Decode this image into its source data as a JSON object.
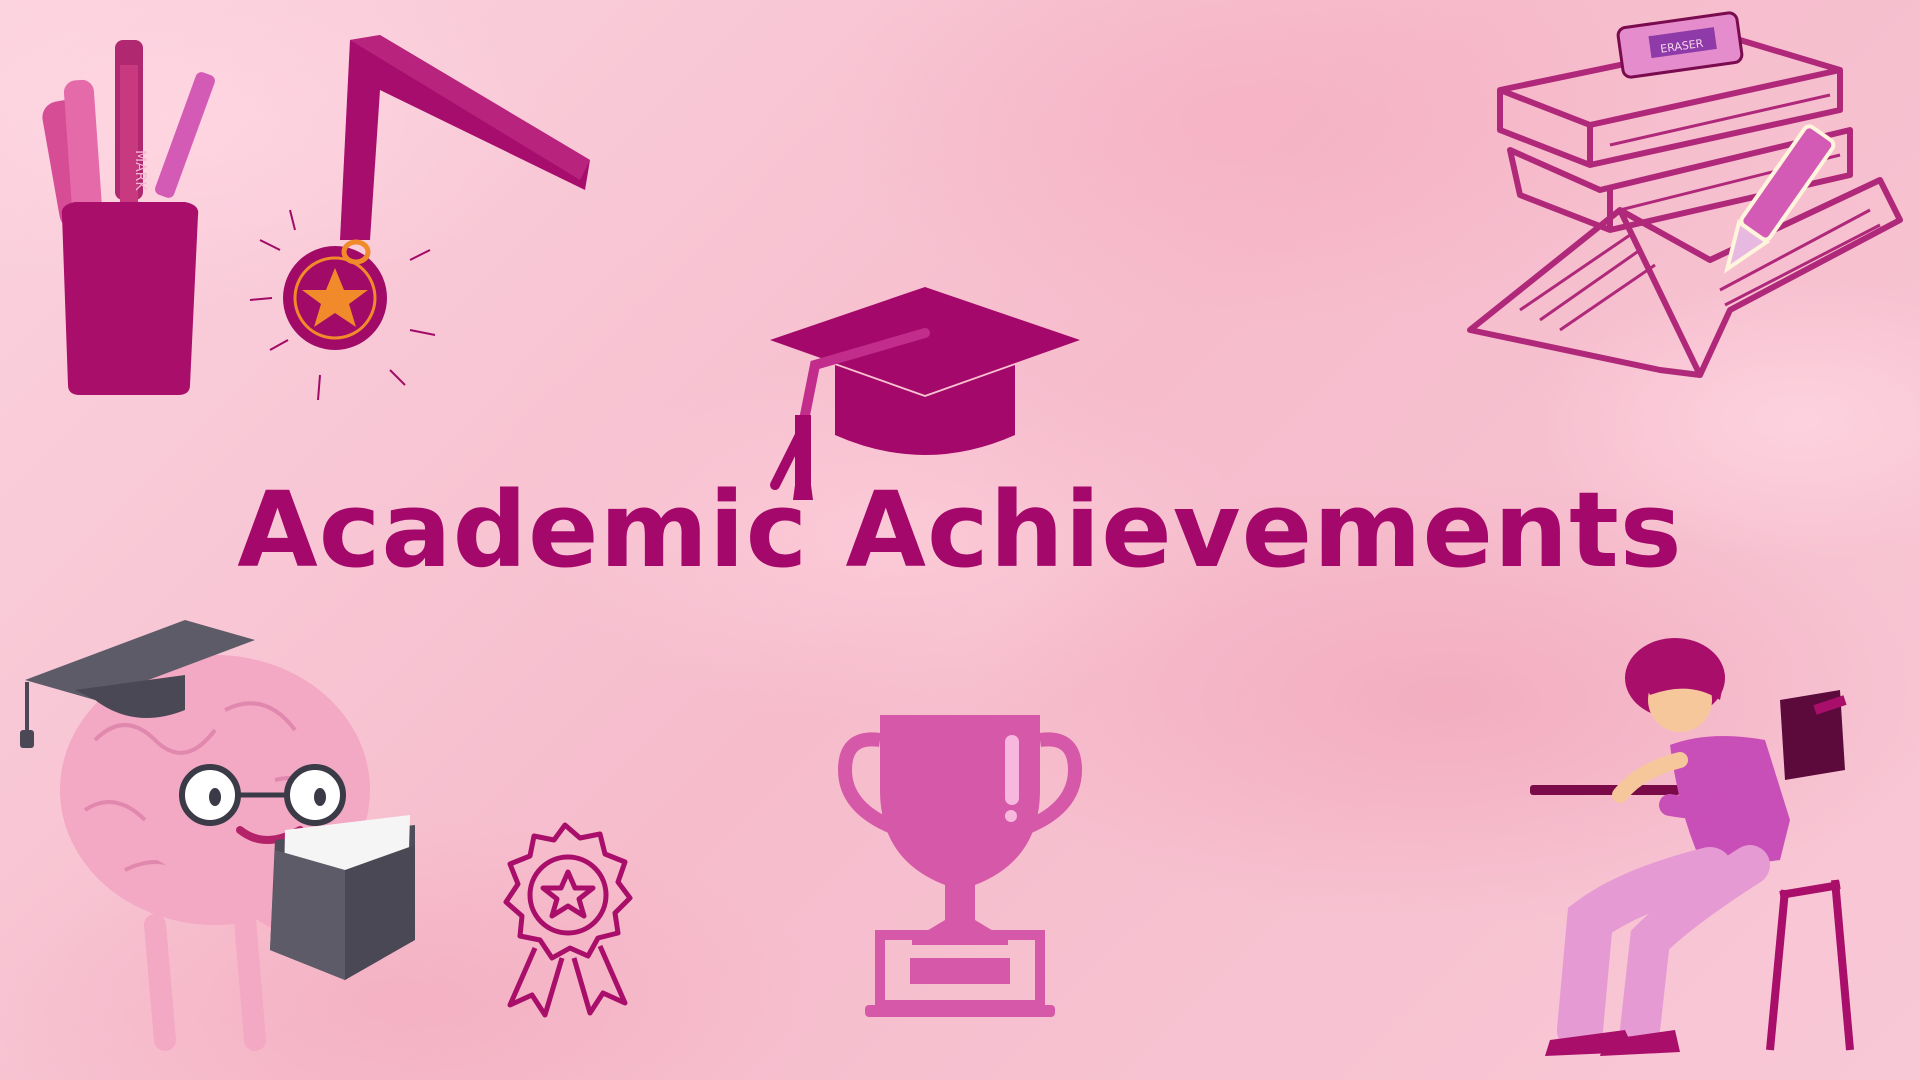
{
  "slide": {
    "title": "Academic Achievements",
    "colors": {
      "primary": "#a3086a",
      "secondary": "#c22d8c",
      "light": "#e07ac0",
      "background": "#f7c4d3"
    }
  },
  "illustrations": [
    "pencil-cup-icon",
    "medal-icon",
    "books-stack-icon",
    "graduation-cap-icon",
    "brain-student-icon",
    "award-rosette-icon",
    "trophy-icon",
    "student-at-desk-icon"
  ],
  "labels": {
    "marker_text": "MARK",
    "eraser_text": "ERASER"
  }
}
